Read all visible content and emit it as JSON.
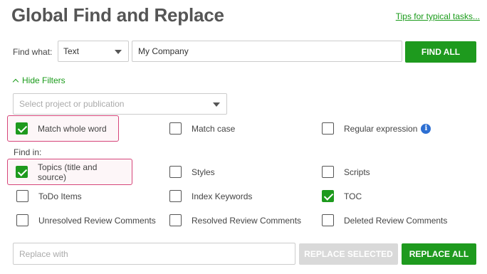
{
  "header": {
    "title": "Global Find and Replace",
    "tips_link": "Tips for typical tasks..."
  },
  "find": {
    "label": "Find what:",
    "type_value": "Text",
    "query_value": "My Company",
    "find_all_label": "FIND ALL"
  },
  "filters": {
    "toggle_label": "Hide Filters",
    "project_placeholder": "Select project or publication"
  },
  "match_options": [
    {
      "label": "Match whole word",
      "checked": true,
      "highlighted": true
    },
    {
      "label": "Match case",
      "checked": false,
      "highlighted": false
    },
    {
      "label": "Regular expression",
      "checked": false,
      "highlighted": false,
      "info_icon": true
    }
  ],
  "find_in": {
    "label": "Find in:",
    "items": [
      {
        "label": "Topics (title and source)",
        "checked": true,
        "highlighted": true
      },
      {
        "label": "Styles",
        "checked": false
      },
      {
        "label": "Scripts",
        "checked": false
      },
      {
        "label": "ToDo Items",
        "checked": false
      },
      {
        "label": "Index Keywords",
        "checked": false
      },
      {
        "label": "TOC",
        "checked": true
      },
      {
        "label": "Unresolved Review Comments",
        "checked": false
      },
      {
        "label": "Resolved Review Comments",
        "checked": false
      },
      {
        "label": "Deleted Review Comments",
        "checked": false
      }
    ]
  },
  "replace": {
    "placeholder": "Replace with",
    "value": "",
    "replace_selected_label": "REPLACE SELECTED",
    "replace_all_label": "REPLACE ALL"
  },
  "colors": {
    "accent": "#1e9a1e",
    "highlight_border": "#d6457a",
    "info": "#2d6fd2",
    "disabled": "#d9d9d9"
  }
}
